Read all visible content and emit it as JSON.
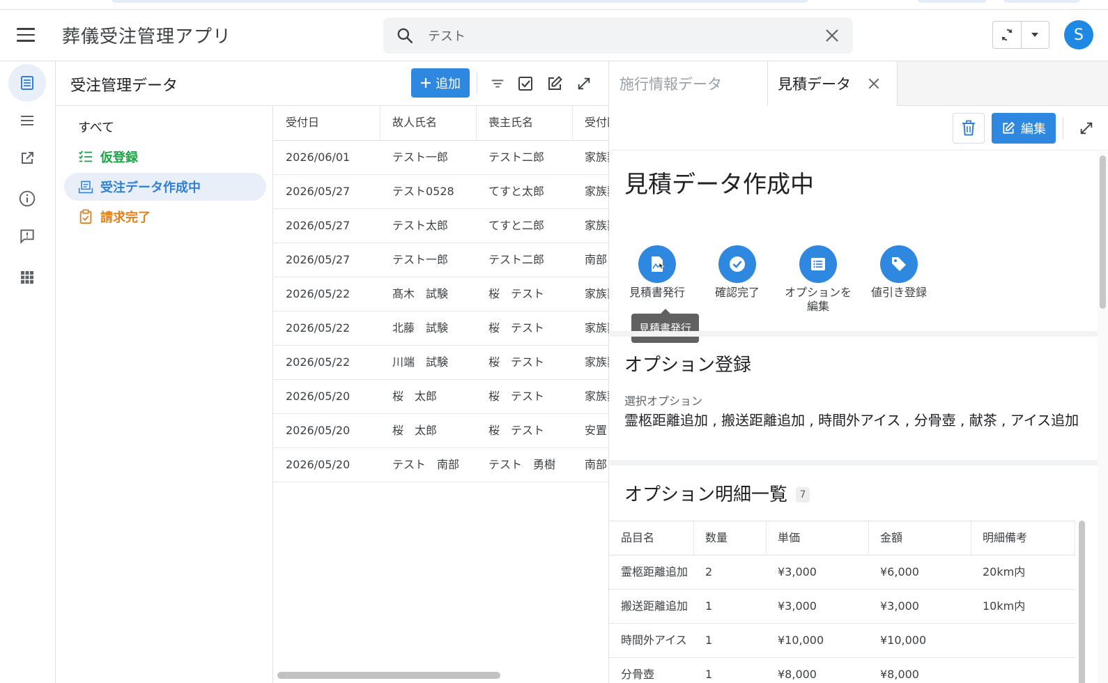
{
  "app": {
    "title": "葬儀受注管理アプリ",
    "avatar_letter": "S",
    "brand_color": "#2f88e0"
  },
  "search": {
    "value": "テスト"
  },
  "list_panel": {
    "title": "受注管理データ",
    "add_label": "追加",
    "filters": [
      {
        "label": "すべて",
        "color": "#202124"
      },
      {
        "label": "仮登録",
        "color": "#1ea446"
      },
      {
        "label": "受注データ作成中",
        "color": "#2f7fd6"
      },
      {
        "label": "請求完了",
        "color": "#e0811b"
      }
    ],
    "columns": [
      "受付日",
      "故人氏名",
      "喪主氏名",
      "受付区分"
    ],
    "rows": [
      [
        "2026/06/01",
        "テスト一郎",
        "テスト二郎",
        "家族葬"
      ],
      [
        "2026/05/27",
        "テスト0528",
        "てすと太郎",
        "家族葬"
      ],
      [
        "2026/05/27",
        "テスト太郎",
        "てすと二郎",
        "家族葬"
      ],
      [
        "2026/05/27",
        "テスト一郎",
        "テスト二郎",
        "南部"
      ],
      [
        "2026/05/22",
        "髙木　試験",
        "桜　テスト",
        "家族葬"
      ],
      [
        "2026/05/22",
        "北藤　試験",
        "桜　テスト",
        "家族葬"
      ],
      [
        "2026/05/22",
        "川端　試験",
        "桜　テスト",
        "家族葬"
      ],
      [
        "2026/05/20",
        "桜　太郎",
        "桜　テスト",
        "家族葬"
      ],
      [
        "2026/05/20",
        "桜　太郎",
        "桜　テスト",
        "安置"
      ],
      [
        "2026/05/20",
        "テスト　南部",
        "テスト　勇樹",
        "南部"
      ]
    ]
  },
  "detail": {
    "tabs": [
      {
        "label": "施行情報データ"
      },
      {
        "label": "見積データ"
      }
    ],
    "edit_label": "編集",
    "status_title": "見積データ作成中",
    "actions": [
      {
        "label": "見積書発行",
        "icon": "document-image-icon"
      },
      {
        "label": "確認完了",
        "icon": "check-circle-icon"
      },
      {
        "label": "オプションを編集",
        "line1": "オプションを",
        "line2": "編集",
        "icon": "list-icon"
      },
      {
        "label": "値引き登録",
        "icon": "tag-icon"
      }
    ],
    "tooltip": "見積書発行",
    "option_section": {
      "title": "オプション登録",
      "field_label": "選択オプション",
      "field_value": "霊柩距離追加 , 搬送距離追加 , 時間外アイス , 分骨壺 , 献茶 , アイス追加"
    },
    "detail_section": {
      "title": "オプション明細一覧",
      "count": "7",
      "columns": [
        "品目名",
        "数量",
        "単価",
        "金額",
        "明細備考"
      ],
      "rows": [
        [
          "霊柩距離追加",
          "2",
          "¥3,000",
          "¥6,000",
          "20km内"
        ],
        [
          "搬送距離追加",
          "1",
          "¥3,000",
          "¥3,000",
          "10km内"
        ],
        [
          "時間外アイス",
          "1",
          "¥10,000",
          "¥10,000",
          ""
        ],
        [
          "分骨壺",
          "1",
          "¥8,000",
          "¥8,000",
          ""
        ]
      ]
    }
  }
}
